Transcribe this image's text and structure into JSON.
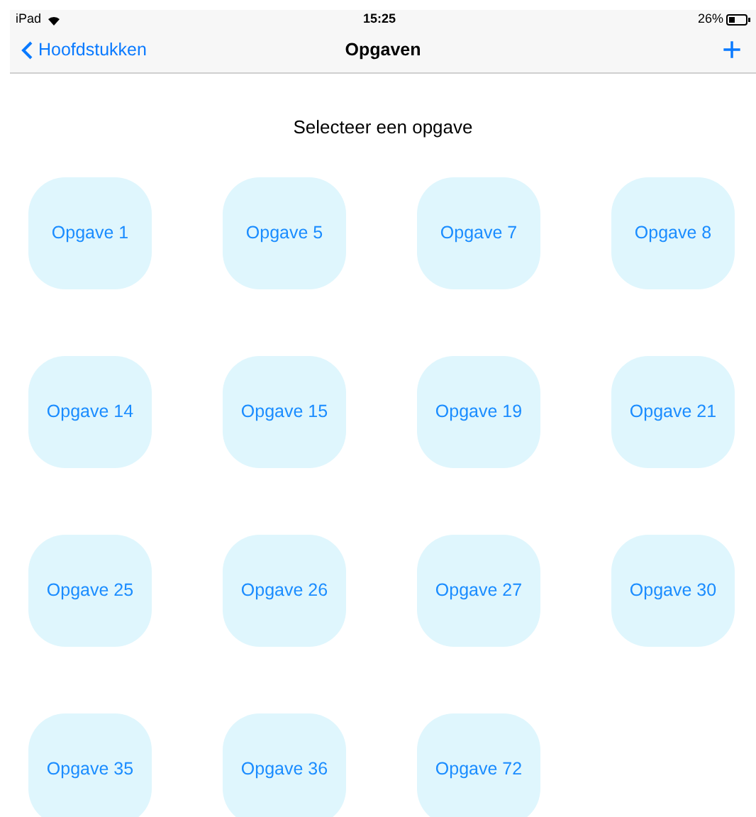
{
  "status_bar": {
    "device": "iPad",
    "time": "15:25",
    "battery": "26%"
  },
  "nav_bar": {
    "back": "Hoofdstukken",
    "title": "Opgaven",
    "add": "+"
  },
  "heading": "Selecteer een opgave",
  "exercises": [
    "Opgave 1",
    "Opgave 5",
    "Opgave 7",
    "Opgave 8",
    "Opgave 14",
    "Opgave 15",
    "Opgave 19",
    "Opgave 21",
    "Opgave 25",
    "Opgave 26",
    "Opgave 27",
    "Opgave 30",
    "Opgave 35",
    "Opgave 36",
    "Opgave 72"
  ]
}
